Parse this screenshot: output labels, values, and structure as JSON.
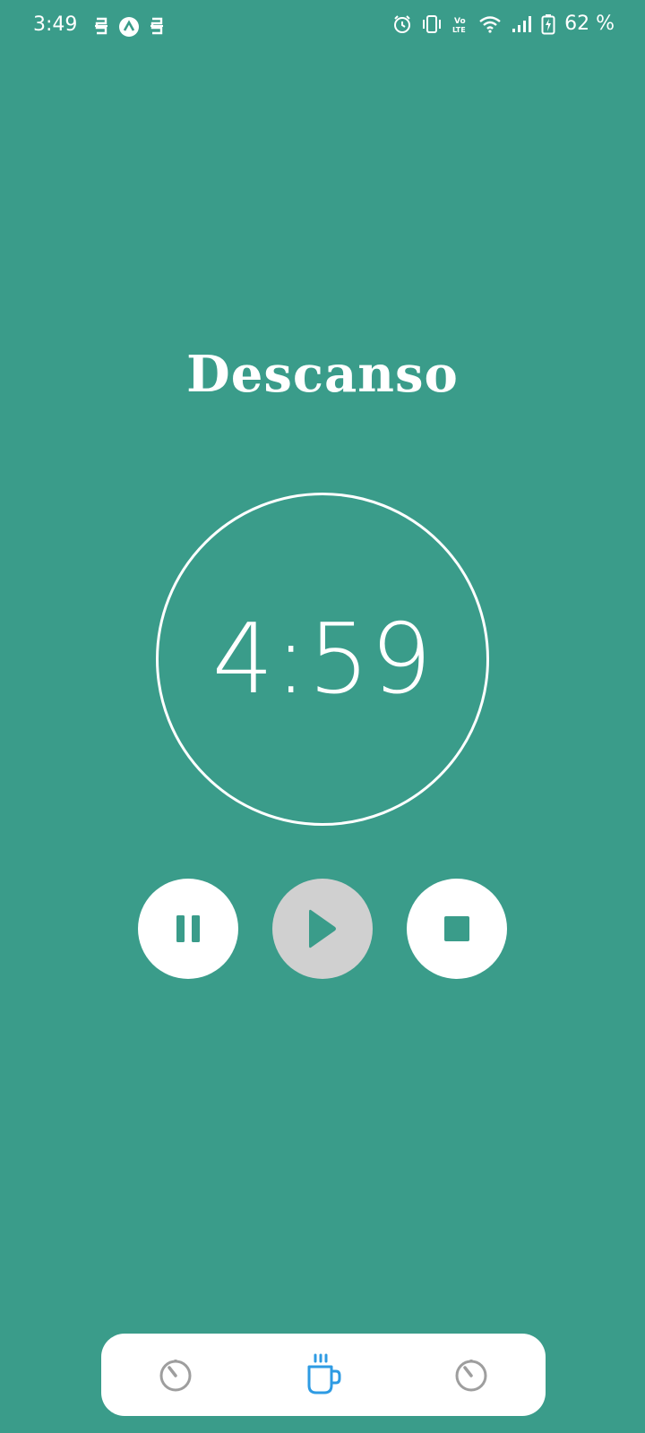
{
  "status_bar": {
    "time": "3:49",
    "battery_text": "62 %",
    "icons": [
      "s-app-icon",
      "a-app-icon",
      "s-app-icon",
      "alarm-icon",
      "vibrate-icon",
      "volte-icon",
      "wifi-icon",
      "signal-icon",
      "battery-charging-icon"
    ]
  },
  "screen": {
    "title": "Descanso",
    "timer": "4:59"
  },
  "controls": {
    "pause_icon": "pause-icon",
    "play_icon": "play-icon",
    "stop_icon": "stop-icon",
    "play_state": "disabled"
  },
  "bottom_nav": {
    "items": [
      {
        "icon": "timer-icon",
        "active": false
      },
      {
        "icon": "coffee-cup-icon",
        "active": true
      },
      {
        "icon": "timer-icon",
        "active": false
      }
    ]
  },
  "colors": {
    "background": "#3a9c8a",
    "foreground": "#ffffff",
    "active_nav": "#2e9be3",
    "inactive_nav": "#9e9e9e",
    "disabled_button": "#d0d0d0",
    "icon_dark": "#3a9c8a"
  }
}
